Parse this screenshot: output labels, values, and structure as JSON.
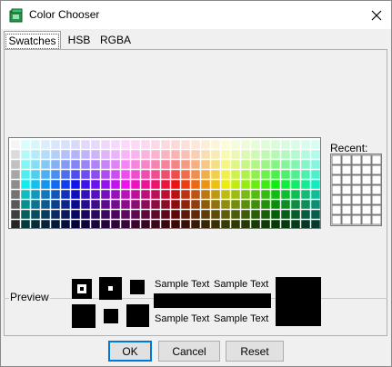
{
  "window": {
    "title": "Color Chooser",
    "icon": "color-chooser-app-icon",
    "close_icon": "close-icon"
  },
  "tabs": [
    {
      "label": "Swatches",
      "selected": true
    },
    {
      "label": "HSB",
      "selected": false
    },
    {
      "label": "RGBA",
      "selected": false
    }
  ],
  "swatches": {
    "grid_columns": 31,
    "grid_rows": 9
  },
  "recent": {
    "label": "Recent:",
    "grid_columns": 5,
    "grid_rows": 7
  },
  "preview": {
    "label": "Preview",
    "sample_text": "Sample Text",
    "color": "#000000"
  },
  "buttons": {
    "ok": "OK",
    "cancel": "Cancel",
    "reset": "Reset"
  },
  "colors": {
    "focus_border": "#0078d7",
    "dialog_background": "#f0f0f0"
  }
}
